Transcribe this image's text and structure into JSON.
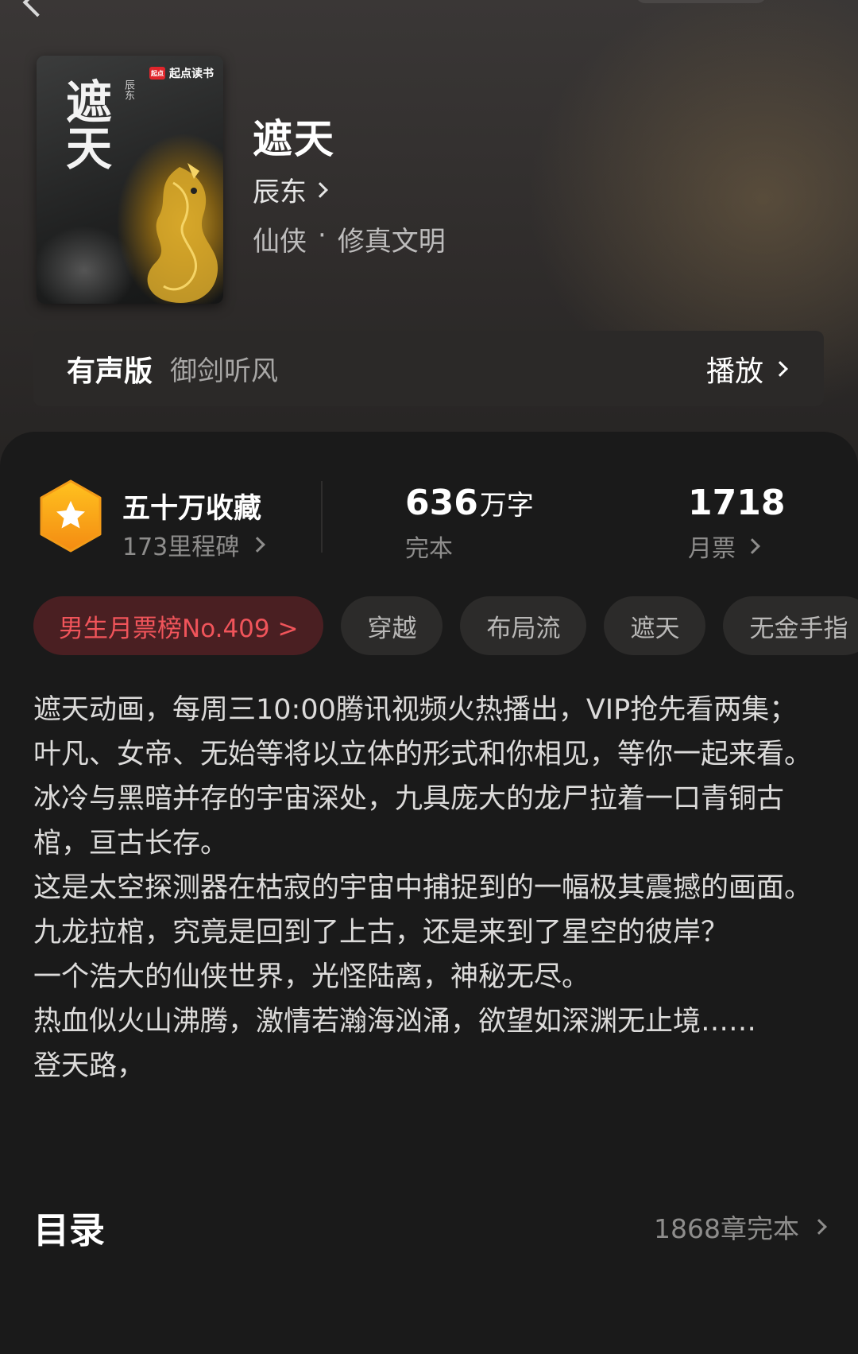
{
  "book": {
    "cover_brand": "起点读书",
    "cover_title": "遮天",
    "cover_author": "辰东",
    "title": "遮天",
    "author": "辰东",
    "genre": "仙侠",
    "subgenre": "修真文明",
    "genre_separator": "·"
  },
  "audio": {
    "label": "有声版",
    "narrator": "御剑听风",
    "play_label": "播放"
  },
  "stats": {
    "favorites_title": "五十万收藏",
    "milestones": "173里程碑",
    "word_count": "636",
    "word_unit": "万字",
    "status": "完本",
    "monthly_votes": "1718",
    "monthly_votes_label": "月票"
  },
  "tags": {
    "rank": "男生月票榜No.409 >",
    "items": [
      "穿越",
      "布局流",
      "遮天",
      "无金手指"
    ]
  },
  "description": [
    "遮天动画，每周三10:00腾讯视频火热播出，VIP抢先看两集；叶凡、女帝、无始等将以立体的形式和你相见，等你一起来看。",
    "冰冷与黑暗并存的宇宙深处，九具庞大的龙尸拉着一口青铜古棺，亘古长存。",
    "这是太空探测器在枯寂的宇宙中捕捉到的一幅极其震撼的画面。",
    "九龙拉棺，究竟是回到了上古，还是来到了星空的彼岸？",
    "一个浩大的仙侠世界，光怪陆离，神秘无尽。",
    "热血似火山沸腾，激情若瀚海汹涌，欲望如深渊无止境……",
    "登天路，"
  ],
  "toc": {
    "title": "目录",
    "count": "1868章完本"
  },
  "colors": {
    "background": "#1a1a1a",
    "rank_tag_bg": "#4a1f22",
    "rank_tag_text": "#f0545a",
    "badge": "#f7a91c"
  },
  "icons": {
    "back": "back-arrow-icon",
    "badge": "star-hexagon-icon",
    "chevron": "chevron-right-icon"
  }
}
